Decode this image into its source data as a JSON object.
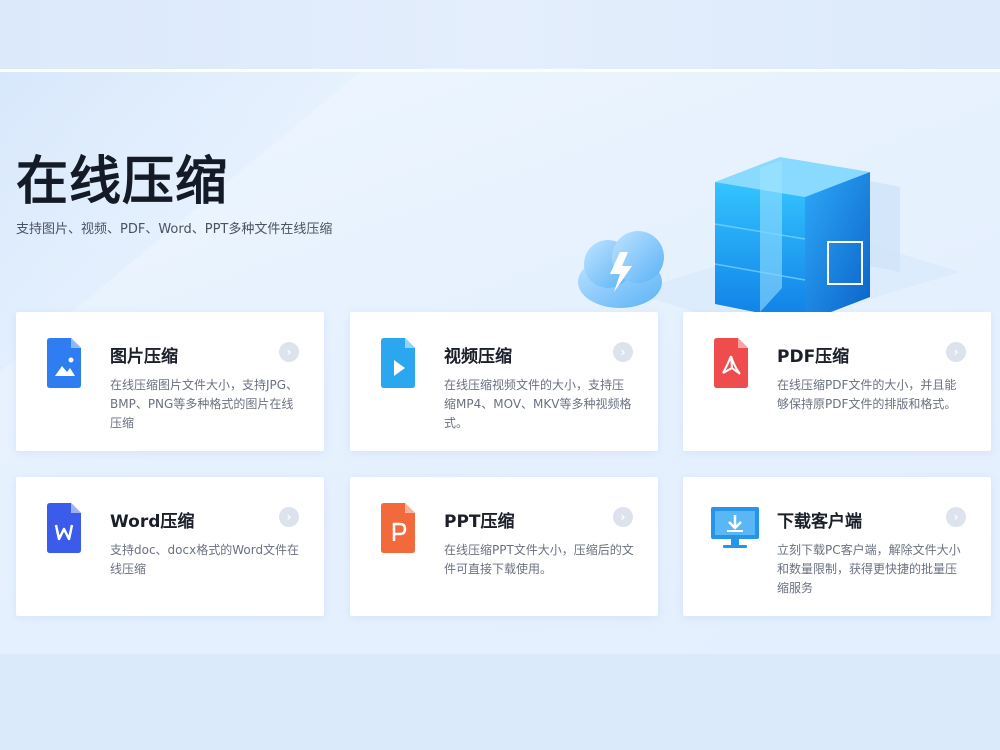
{
  "hero": {
    "title": "在线压缩",
    "subtitle": "支持图片、视频、PDF、Word、PPT多种文件在线压缩"
  },
  "cards": [
    {
      "title": "图片压缩",
      "desc": "在线压缩图片文件大小，支持JPG、BMP、PNG等多种格式的图片在线压缩",
      "icon": "image-file-icon",
      "color": "#2f7df0"
    },
    {
      "title": "视频压缩",
      "desc": "在线压缩视频文件的大小，支持压缩MP4、MOV、MKV等多种视频格式。",
      "icon": "video-file-icon",
      "color": "#2aa7ef"
    },
    {
      "title": "PDF压缩",
      "desc": "在线压缩PDF文件的大小，并且能够保持原PDF文件的排版和格式。",
      "icon": "pdf-file-icon",
      "color": "#ef4d4d"
    },
    {
      "title": "Word压缩",
      "desc": "支持doc、docx格式的Word文件在线压缩",
      "icon": "word-file-icon",
      "color": "#3b5bea"
    },
    {
      "title": "PPT压缩",
      "desc": "在线压缩PPT文件大小，压缩后的文件可直接下载使用。",
      "icon": "ppt-file-icon",
      "color": "#f26a3b"
    },
    {
      "title": "下载客户端",
      "desc": "立刻下载PC客户端，解除文件大小和数量限制，获得更快捷的批量压缩服务",
      "icon": "desktop-download-icon",
      "color": "#2595ea"
    }
  ],
  "arrow_glyph": "›"
}
